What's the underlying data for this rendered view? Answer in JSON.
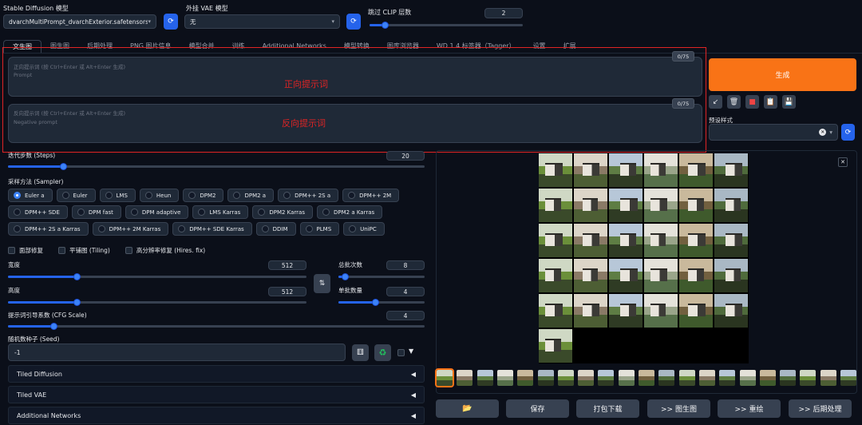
{
  "top": {
    "model_label": "Stable Diffusion 模型",
    "model_value": "dvarchMultiPrompt_dvarchExterior.safetensors [4",
    "vae_label": "外挂 VAE 模型",
    "vae_value": "无",
    "clip_label": "跳过 CLIP 层数",
    "clip_value": "2",
    "clip_fraction": 0.1
  },
  "tabs": [
    "文生图",
    "图生图",
    "后期处理",
    "PNG 图片信息",
    "模型合并",
    "训练",
    "Additional Networks",
    "模型转换",
    "图库浏览器",
    "WD 1.4 标签器（Tagger）",
    "设置",
    "扩展"
  ],
  "prompt": {
    "placeholder_cn": "正向提示词 (按 Ctrl+Enter 或 Alt+Enter 生成)",
    "placeholder_en": "Prompt",
    "counter": "0/75",
    "annotation": "正向提示词"
  },
  "negative": {
    "placeholder_cn": "反向提示词 (按 Ctrl+Enter 或 Alt+Enter 生成)",
    "placeholder_en": "Negative prompt",
    "counter": "0/75",
    "annotation": "反向提示词"
  },
  "generate_label": "生成",
  "styles_label": "预设样式",
  "steps": {
    "label": "迭代步数 (Steps)",
    "value": "20",
    "fraction": 0.133
  },
  "sampler": {
    "label": "采样方法 (Sampler)",
    "selected": "Euler a",
    "options": [
      "Euler a",
      "Euler",
      "LMS",
      "Heun",
      "DPM2",
      "DPM2 a",
      "DPM++ 2S a",
      "DPM++ 2M",
      "DPM++ SDE",
      "DPM fast",
      "DPM adaptive",
      "LMS Karras",
      "DPM2 Karras",
      "DPM2 a Karras",
      "DPM++ 2S a Karras",
      "DPM++ 2M Karras",
      "DPM++ SDE Karras",
      "DDIM",
      "PLMS",
      "UniPC"
    ]
  },
  "checks": {
    "face": "面部修复",
    "tiling": "平铺图 (Tiling)",
    "hires": "高分辨率修复 (Hires. fix)"
  },
  "width": {
    "label": "宽度",
    "value": "512",
    "fraction": 0.23
  },
  "height": {
    "label": "高度",
    "value": "512",
    "fraction": 0.23
  },
  "batch_count": {
    "label": "总批次数",
    "value": "8",
    "fraction": 0.07
  },
  "batch_size": {
    "label": "单批数量",
    "value": "4",
    "fraction": 0.43
  },
  "cfg": {
    "label": "提示词引导系数 (CFG Scale)",
    "value": "4",
    "fraction": 0.11
  },
  "seed": {
    "label": "随机数种子 (Seed)",
    "value": "-1"
  },
  "accordions": [
    "Tiled Diffusion",
    "Tiled VAE",
    "Additional Networks"
  ],
  "bottom_buttons": [
    "",
    "保存",
    "打包下载",
    ">> 图生图",
    ">> 重绘",
    ">> 后期处理"
  ],
  "icons": {
    "refresh": "refresh-icon",
    "swap": "swap-icon",
    "dice": "dice-icon",
    "recycle": "recycle-icon",
    "folder": "folder-icon",
    "close": "close-icon",
    "triangle": "triangle-left-icon"
  },
  "colors": {
    "accent": "#2563eb",
    "generate": "#f97316",
    "annotation": "#e02424",
    "background": "#0b0f19"
  }
}
